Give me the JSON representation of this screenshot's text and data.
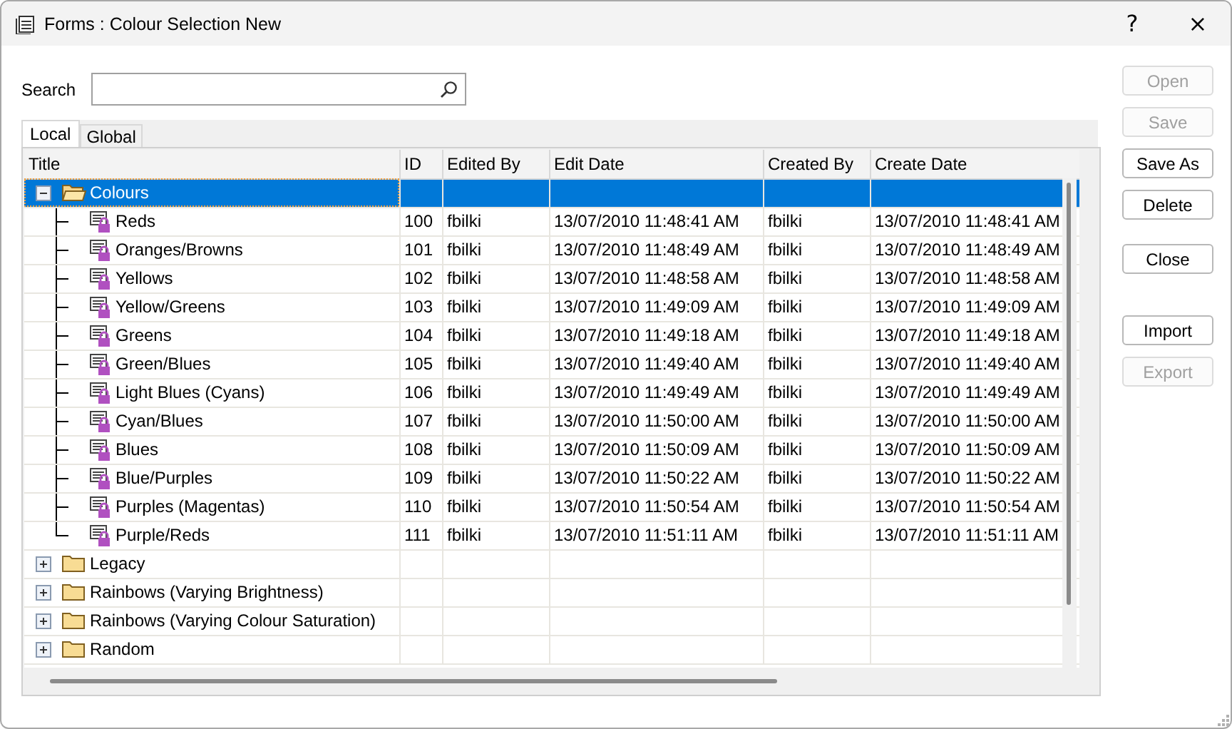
{
  "window": {
    "title": "Forms : Colour Selection New",
    "help": "?",
    "close": "×"
  },
  "search": {
    "label": "Search"
  },
  "tabs": [
    {
      "label": "Local",
      "selected": true
    },
    {
      "label": "Global",
      "selected": false
    }
  ],
  "table": {
    "columns": [
      "Title",
      "ID",
      "Edited By",
      "Edit Date",
      "Created By",
      "Create Date"
    ],
    "rows": [
      {
        "title": "Colours",
        "selected": true,
        "expanded": true,
        "children": [
          {
            "title": "Reds",
            "id": "100",
            "edited_by": "fbilki",
            "edit_date": "13/07/2010 11:48:41 AM",
            "created_by": "fbilki",
            "create_date": "13/07/2010 11:48:41 AM"
          },
          {
            "title": "Oranges/Browns",
            "id": "101",
            "edited_by": "fbilki",
            "edit_date": "13/07/2010 11:48:49 AM",
            "created_by": "fbilki",
            "create_date": "13/07/2010 11:48:49 AM"
          },
          {
            "title": "Yellows",
            "id": "102",
            "edited_by": "fbilki",
            "edit_date": "13/07/2010 11:48:58 AM",
            "created_by": "fbilki",
            "create_date": "13/07/2010 11:48:58 AM"
          },
          {
            "title": "Yellow/Greens",
            "id": "103",
            "edited_by": "fbilki",
            "edit_date": "13/07/2010 11:49:09 AM",
            "created_by": "fbilki",
            "create_date": "13/07/2010 11:49:09 AM"
          },
          {
            "title": "Greens",
            "id": "104",
            "edited_by": "fbilki",
            "edit_date": "13/07/2010 11:49:18 AM",
            "created_by": "fbilki",
            "create_date": "13/07/2010 11:49:18 AM"
          },
          {
            "title": "Green/Blues",
            "id": "105",
            "edited_by": "fbilki",
            "edit_date": "13/07/2010 11:49:40 AM",
            "created_by": "fbilki",
            "create_date": "13/07/2010 11:49:40 AM"
          },
          {
            "title": "Light Blues (Cyans)",
            "id": "106",
            "edited_by": "fbilki",
            "edit_date": "13/07/2010 11:49:49 AM",
            "created_by": "fbilki",
            "create_date": "13/07/2010 11:49:49 AM"
          },
          {
            "title": "Cyan/Blues",
            "id": "107",
            "edited_by": "fbilki",
            "edit_date": "13/07/2010 11:50:00 AM",
            "created_by": "fbilki",
            "create_date": "13/07/2010 11:50:00 AM"
          },
          {
            "title": "Blues",
            "id": "108",
            "edited_by": "fbilki",
            "edit_date": "13/07/2010 11:50:09 AM",
            "created_by": "fbilki",
            "create_date": "13/07/2010 11:50:09 AM"
          },
          {
            "title": "Blue/Purples",
            "id": "109",
            "edited_by": "fbilki",
            "edit_date": "13/07/2010 11:50:22 AM",
            "created_by": "fbilki",
            "create_date": "13/07/2010 11:50:22 AM"
          },
          {
            "title": "Purples (Magentas)",
            "id": "110",
            "edited_by": "fbilki",
            "edit_date": "13/07/2010 11:50:54 AM",
            "created_by": "fbilki",
            "create_date": "13/07/2010 11:50:54 AM"
          },
          {
            "title": "Purple/Reds",
            "id": "111",
            "edited_by": "fbilki",
            "edit_date": "13/07/2010 11:51:11 AM",
            "created_by": "fbilki",
            "create_date": "13/07/2010 11:51:11 AM"
          }
        ]
      },
      {
        "title": "Legacy",
        "selected": false,
        "expanded": false
      },
      {
        "title": "Rainbows (Varying Brightness)",
        "selected": false,
        "expanded": false
      },
      {
        "title": "Rainbows (Varying Colour Saturation)",
        "selected": false,
        "expanded": false
      },
      {
        "title": "Random",
        "selected": false,
        "expanded": false
      }
    ]
  },
  "button_groups": [
    [
      {
        "label": "Open",
        "disabled": true
      },
      {
        "label": "Save",
        "disabled": true
      },
      {
        "label": "Save As",
        "disabled": false
      },
      {
        "label": "Delete",
        "disabled": false
      }
    ],
    [
      {
        "label": "Close",
        "disabled": false
      }
    ],
    [
      {
        "label": "Import",
        "disabled": false
      },
      {
        "label": "Export",
        "disabled": true
      }
    ]
  ]
}
